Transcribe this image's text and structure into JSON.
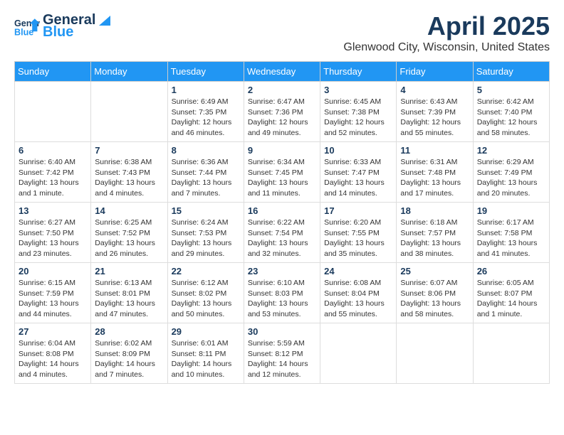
{
  "header": {
    "logo_general": "General",
    "logo_blue": "Blue",
    "month_title": "April 2025",
    "location": "Glenwood City, Wisconsin, United States"
  },
  "weekdays": [
    "Sunday",
    "Monday",
    "Tuesday",
    "Wednesday",
    "Thursday",
    "Friday",
    "Saturday"
  ],
  "weeks": [
    [
      {
        "day": "",
        "info": ""
      },
      {
        "day": "",
        "info": ""
      },
      {
        "day": "1",
        "sunrise": "Sunrise: 6:49 AM",
        "sunset": "Sunset: 7:35 PM",
        "daylight": "Daylight: 12 hours and 46 minutes."
      },
      {
        "day": "2",
        "sunrise": "Sunrise: 6:47 AM",
        "sunset": "Sunset: 7:36 PM",
        "daylight": "Daylight: 12 hours and 49 minutes."
      },
      {
        "day": "3",
        "sunrise": "Sunrise: 6:45 AM",
        "sunset": "Sunset: 7:38 PM",
        "daylight": "Daylight: 12 hours and 52 minutes."
      },
      {
        "day": "4",
        "sunrise": "Sunrise: 6:43 AM",
        "sunset": "Sunset: 7:39 PM",
        "daylight": "Daylight: 12 hours and 55 minutes."
      },
      {
        "day": "5",
        "sunrise": "Sunrise: 6:42 AM",
        "sunset": "Sunset: 7:40 PM",
        "daylight": "Daylight: 12 hours and 58 minutes."
      }
    ],
    [
      {
        "day": "6",
        "sunrise": "Sunrise: 6:40 AM",
        "sunset": "Sunset: 7:42 PM",
        "daylight": "Daylight: 13 hours and 1 minute."
      },
      {
        "day": "7",
        "sunrise": "Sunrise: 6:38 AM",
        "sunset": "Sunset: 7:43 PM",
        "daylight": "Daylight: 13 hours and 4 minutes."
      },
      {
        "day": "8",
        "sunrise": "Sunrise: 6:36 AM",
        "sunset": "Sunset: 7:44 PM",
        "daylight": "Daylight: 13 hours and 7 minutes."
      },
      {
        "day": "9",
        "sunrise": "Sunrise: 6:34 AM",
        "sunset": "Sunset: 7:45 PM",
        "daylight": "Daylight: 13 hours and 11 minutes."
      },
      {
        "day": "10",
        "sunrise": "Sunrise: 6:33 AM",
        "sunset": "Sunset: 7:47 PM",
        "daylight": "Daylight: 13 hours and 14 minutes."
      },
      {
        "day": "11",
        "sunrise": "Sunrise: 6:31 AM",
        "sunset": "Sunset: 7:48 PM",
        "daylight": "Daylight: 13 hours and 17 minutes."
      },
      {
        "day": "12",
        "sunrise": "Sunrise: 6:29 AM",
        "sunset": "Sunset: 7:49 PM",
        "daylight": "Daylight: 13 hours and 20 minutes."
      }
    ],
    [
      {
        "day": "13",
        "sunrise": "Sunrise: 6:27 AM",
        "sunset": "Sunset: 7:50 PM",
        "daylight": "Daylight: 13 hours and 23 minutes."
      },
      {
        "day": "14",
        "sunrise": "Sunrise: 6:25 AM",
        "sunset": "Sunset: 7:52 PM",
        "daylight": "Daylight: 13 hours and 26 minutes."
      },
      {
        "day": "15",
        "sunrise": "Sunrise: 6:24 AM",
        "sunset": "Sunset: 7:53 PM",
        "daylight": "Daylight: 13 hours and 29 minutes."
      },
      {
        "day": "16",
        "sunrise": "Sunrise: 6:22 AM",
        "sunset": "Sunset: 7:54 PM",
        "daylight": "Daylight: 13 hours and 32 minutes."
      },
      {
        "day": "17",
        "sunrise": "Sunrise: 6:20 AM",
        "sunset": "Sunset: 7:55 PM",
        "daylight": "Daylight: 13 hours and 35 minutes."
      },
      {
        "day": "18",
        "sunrise": "Sunrise: 6:18 AM",
        "sunset": "Sunset: 7:57 PM",
        "daylight": "Daylight: 13 hours and 38 minutes."
      },
      {
        "day": "19",
        "sunrise": "Sunrise: 6:17 AM",
        "sunset": "Sunset: 7:58 PM",
        "daylight": "Daylight: 13 hours and 41 minutes."
      }
    ],
    [
      {
        "day": "20",
        "sunrise": "Sunrise: 6:15 AM",
        "sunset": "Sunset: 7:59 PM",
        "daylight": "Daylight: 13 hours and 44 minutes."
      },
      {
        "day": "21",
        "sunrise": "Sunrise: 6:13 AM",
        "sunset": "Sunset: 8:01 PM",
        "daylight": "Daylight: 13 hours and 47 minutes."
      },
      {
        "day": "22",
        "sunrise": "Sunrise: 6:12 AM",
        "sunset": "Sunset: 8:02 PM",
        "daylight": "Daylight: 13 hours and 50 minutes."
      },
      {
        "day": "23",
        "sunrise": "Sunrise: 6:10 AM",
        "sunset": "Sunset: 8:03 PM",
        "daylight": "Daylight: 13 hours and 53 minutes."
      },
      {
        "day": "24",
        "sunrise": "Sunrise: 6:08 AM",
        "sunset": "Sunset: 8:04 PM",
        "daylight": "Daylight: 13 hours and 55 minutes."
      },
      {
        "day": "25",
        "sunrise": "Sunrise: 6:07 AM",
        "sunset": "Sunset: 8:06 PM",
        "daylight": "Daylight: 13 hours and 58 minutes."
      },
      {
        "day": "26",
        "sunrise": "Sunrise: 6:05 AM",
        "sunset": "Sunset: 8:07 PM",
        "daylight": "Daylight: 14 hours and 1 minute."
      }
    ],
    [
      {
        "day": "27",
        "sunrise": "Sunrise: 6:04 AM",
        "sunset": "Sunset: 8:08 PM",
        "daylight": "Daylight: 14 hours and 4 minutes."
      },
      {
        "day": "28",
        "sunrise": "Sunrise: 6:02 AM",
        "sunset": "Sunset: 8:09 PM",
        "daylight": "Daylight: 14 hours and 7 minutes."
      },
      {
        "day": "29",
        "sunrise": "Sunrise: 6:01 AM",
        "sunset": "Sunset: 8:11 PM",
        "daylight": "Daylight: 14 hours and 10 minutes."
      },
      {
        "day": "30",
        "sunrise": "Sunrise: 5:59 AM",
        "sunset": "Sunset: 8:12 PM",
        "daylight": "Daylight: 14 hours and 12 minutes."
      },
      {
        "day": "",
        "info": ""
      },
      {
        "day": "",
        "info": ""
      },
      {
        "day": "",
        "info": ""
      }
    ]
  ]
}
